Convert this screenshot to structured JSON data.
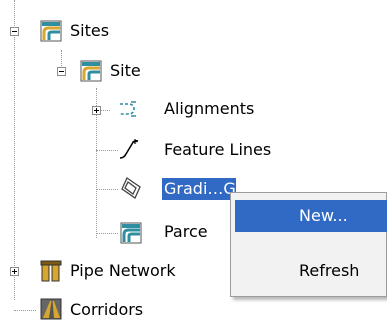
{
  "tree": {
    "sites": {
      "label": "Sites",
      "expanded": true
    },
    "site": {
      "label": "Site",
      "expanded": true
    },
    "alignments": {
      "label": "Alignments",
      "expanded": false
    },
    "feature_lines": {
      "label": "Feature Lines"
    },
    "gradings": {
      "label": "Gradi…G",
      "selected": true
    },
    "parcels": {
      "label": "Parce"
    },
    "pipe_networks": {
      "label": "Pipe Network",
      "expanded": false
    },
    "corridors": {
      "label": "Corridors"
    }
  },
  "context_menu": {
    "items": [
      {
        "label": "New...",
        "highlighted": true
      },
      {
        "label": "Refresh",
        "highlighted": false
      }
    ]
  },
  "colors": {
    "selection": "#316ac5",
    "menu_background": "#f2f2f2",
    "icon_teal": "#2f8ea0",
    "icon_gold": "#d6a62e"
  }
}
